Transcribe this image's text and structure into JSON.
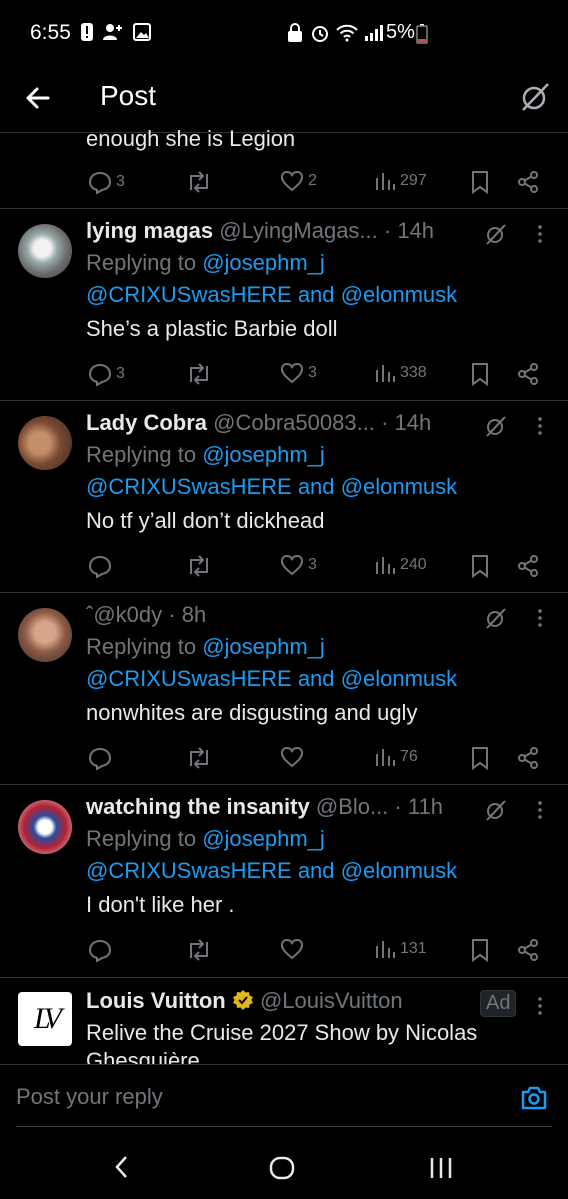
{
  "status_bar": {
    "time": "6:55",
    "battery": "5%"
  },
  "header": {
    "title": "Post",
    "back_icon": "arrow-left-icon",
    "grok_icon": "grok-icon"
  },
  "partial_post": {
    "text": "enough she is Legion",
    "replies": "3",
    "reposts": "",
    "likes": "2",
    "views": "297"
  },
  "posts": [
    {
      "name": "lying magas",
      "handle": "@LyingMagas...",
      "time": "· 14h",
      "replying_prefix": "Replying to ",
      "reply_to_1": "@josephm_j",
      "reply_to_2": "@CRIXUSwasHERE",
      "and_text": " and ",
      "reply_to_3": "@elonmusk",
      "text": "She’s a plastic Barbie doll",
      "replies": "3",
      "reposts": "",
      "likes": "3",
      "views": "338"
    },
    {
      "name": "Lady Cobra",
      "handle": "@Cobra50083...",
      "time": "· 14h",
      "replying_prefix": "Replying to ",
      "reply_to_1": "@josephm_j",
      "reply_to_2": "@CRIXUSwasHERE",
      "and_text": " and ",
      "reply_to_3": "@elonmusk",
      "text": "No tf y’all don’t dickhead",
      "replies": "",
      "reposts": "",
      "likes": "3",
      "views": "240"
    },
    {
      "name": "",
      "handle": "ˆ@k0dy",
      "time": "· 8h",
      "replying_prefix": "Replying to ",
      "reply_to_1": "@josephm_j",
      "reply_to_2": "@CRIXUSwasHERE",
      "and_text": " and ",
      "reply_to_3": "@elonmusk",
      "text": "nonwhites are disgusting and ugly",
      "replies": "",
      "reposts": "",
      "likes": "",
      "views": "76"
    },
    {
      "name": "watching the insanity",
      "handle": "@Blo...",
      "time": "· 11h",
      "replying_prefix": "Replying to ",
      "reply_to_1": "@josephm_j",
      "reply_to_2": "@CRIXUSwasHERE",
      "and_text": " and ",
      "reply_to_3": "@elonmusk",
      "text": "I don't like her .",
      "replies": "",
      "reposts": "",
      "likes": "",
      "views": "131"
    }
  ],
  "ad": {
    "name": "Louis Vuitton",
    "handle": "@LouisVuitton",
    "badge": "Ad",
    "text_line1": "Relive the Cruise 2027 Show by Nicolas",
    "text_line2": "Ghesquière",
    "logo_text": "LV"
  },
  "reply_bar": {
    "placeholder": "Post your reply",
    "camera_icon": "camera-icon"
  },
  "nav_bar": {
    "back": "back-nav-icon",
    "home": "home-nav-icon",
    "recents": "recents-nav-icon"
  },
  "colors": {
    "background": "#000000",
    "link": "#1d9bf0",
    "muted": "#71767b",
    "text": "#e7e9ea",
    "divider": "#2f3336"
  }
}
